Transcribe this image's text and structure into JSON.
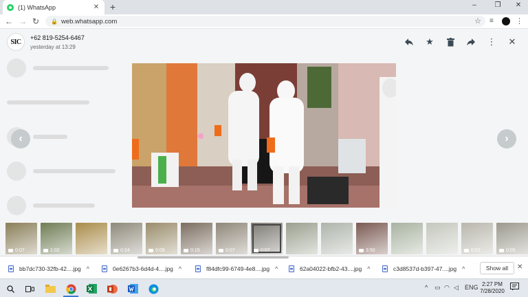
{
  "browser": {
    "tab_title": "(1) WhatsApp",
    "tab_close": "✕",
    "new_tab": "+",
    "url": "web.whatsapp.com",
    "window_controls": [
      "–",
      "❐",
      "✕"
    ],
    "nav": {
      "back": "←",
      "forward": "→",
      "reload": "↻"
    }
  },
  "viewer": {
    "sender_name": "+62 819-5254-6467",
    "sender_time": "yesterday at 13:29",
    "avatar_text": "SIC",
    "actions": {
      "reply": "reply-icon",
      "star": "star-icon",
      "delete": "trash-icon",
      "forward": "forward-icon",
      "menu": "more-vertical-icon",
      "close": "close-icon"
    },
    "prev_arrow": "‹",
    "next_arrow": "›"
  },
  "thumbnails": [
    {
      "duration": "0:07",
      "bg": "#8a7f5a"
    },
    {
      "duration": "1:02",
      "bg": "#6f7d55"
    },
    {
      "duration": "",
      "bg": "#a98c4a"
    },
    {
      "duration": "0:24",
      "bg": "#8e8a7a"
    },
    {
      "duration": "0:09",
      "bg": "#9a8d6c"
    },
    {
      "duration": "0:15",
      "bg": "#7c6e60"
    },
    {
      "duration": "0:07",
      "bg": "#8f8779"
    },
    {
      "duration": "0:07",
      "bg": "#7d7a72",
      "active": true
    },
    {
      "duration": "",
      "bg": "#9ba08f"
    },
    {
      "duration": "",
      "bg": "#aeb4ab"
    },
    {
      "duration": "3:50",
      "bg": "#7b5a52"
    },
    {
      "duration": "",
      "bg": "#a8b3a1"
    },
    {
      "duration": "",
      "bg": "#c4c7bd"
    },
    {
      "duration": "0:02",
      "bg": "#b9b7ac"
    },
    {
      "duration": "0:05",
      "bg": "#9c9a8e"
    }
  ],
  "downloads": {
    "files": [
      "bb7dc730-32fb-42....jpg",
      "0e6267b3-6d4d-4....jpg",
      "f84dfc99-6749-4e8....jpg",
      "62a04022-bfb2-43....jpg",
      "c3d8537d-b397-47....jpg"
    ],
    "caret": "^",
    "show_all": "Show all",
    "close": "✕"
  },
  "taskbar": {
    "language": "ENG",
    "time": "2:27 PM",
    "date": "7/28/2020"
  }
}
